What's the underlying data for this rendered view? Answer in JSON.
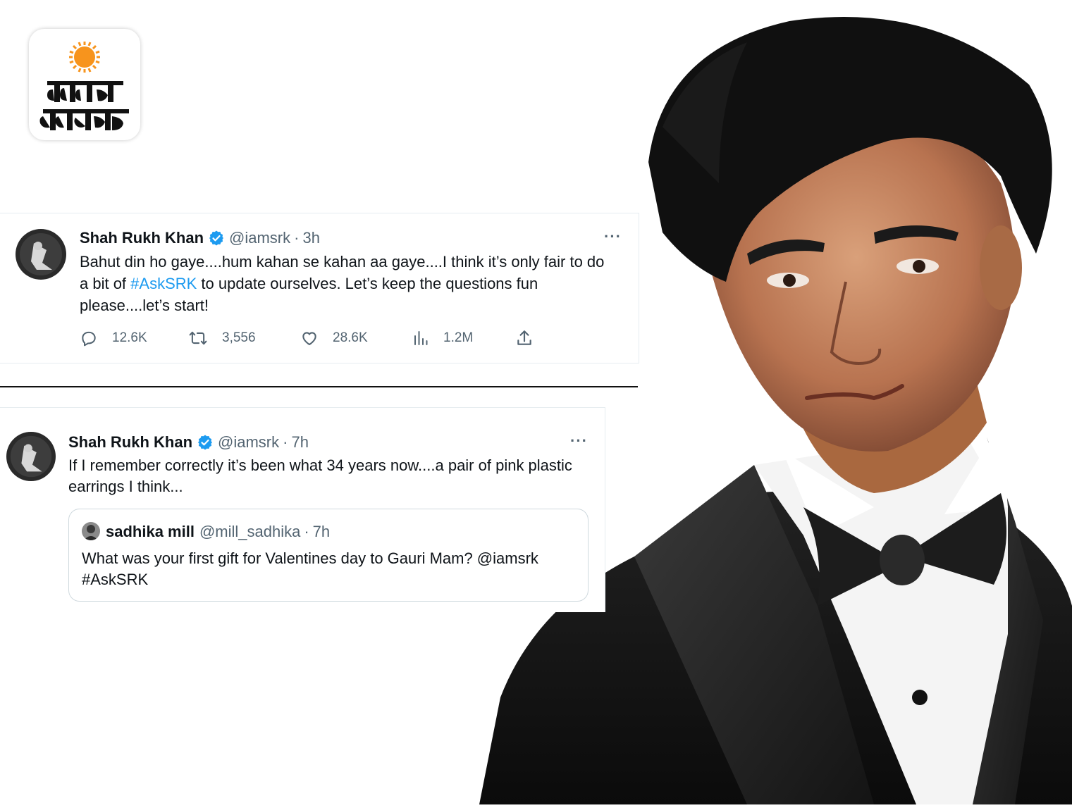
{
  "logo": {
    "line1": "दैनिक",
    "line2": "भास्कर",
    "sun_color": "#f7941d",
    "icon": "dainik-bhaskar-logo-icon"
  },
  "tweets": [
    {
      "author_name": "Shah Rukh Khan",
      "handle": "@iamsrk",
      "separator": "·",
      "time": "3h",
      "more_label": "···",
      "text_before": "Bahut din ho gaye....hum kahan se kahan aa gaye....I think it’s only fair to do a bit of ",
      "hashtag": "#AskSRK",
      "text_after": " to update ourselves. Let’s keep the questions fun please....let’s start!",
      "stats": {
        "replies": "12.6K",
        "retweets": "3,556",
        "likes": "28.6K",
        "views": "1.2M"
      }
    },
    {
      "author_name": "Shah Rukh Khan",
      "handle": "@iamsrk",
      "separator": "·",
      "time": "7h",
      "more_label": "···",
      "text": "If I remember correctly it’s been what 34 years now....a pair of pink plastic earrings I think...",
      "quote": {
        "author_name": "sadhika mill",
        "handle": "@mill_sadhika",
        "separator": "·",
        "time": "7h",
        "text": "What was your first gift for Valentines day to Gauri Mam? @iamsrk #AskSRK"
      }
    }
  ],
  "colors": {
    "verified": "#1d9bf0",
    "hashtag": "#1d9bf0",
    "secondary_text": "#536471"
  }
}
